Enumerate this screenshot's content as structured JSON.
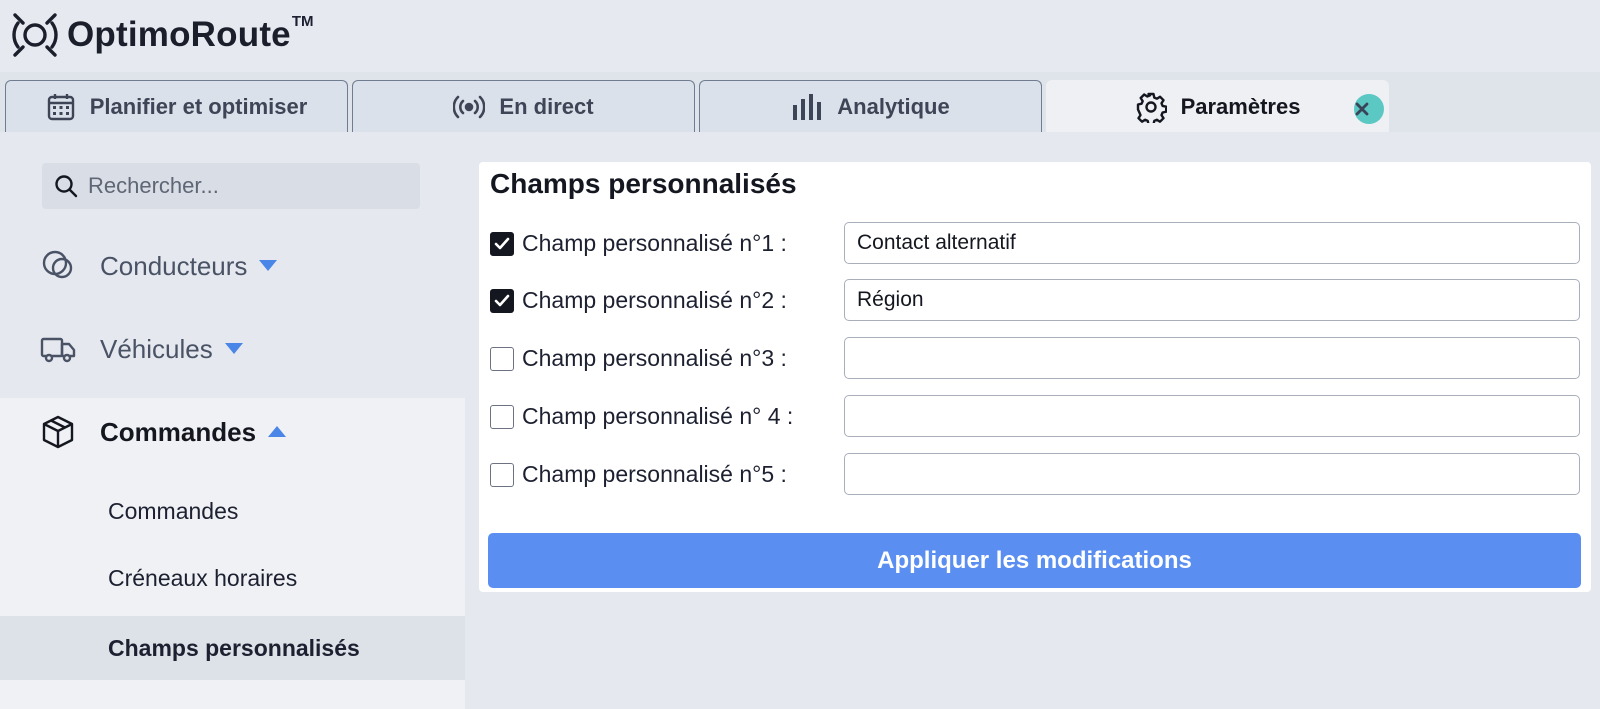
{
  "app": {
    "name": "OptimoRoute",
    "trademark": "TM"
  },
  "tabs": [
    {
      "label": "Planifier et optimiser",
      "icon": "calendar-icon"
    },
    {
      "label": "En direct",
      "icon": "broadcast-icon"
    },
    {
      "label": "Analytique",
      "icon": "bar-chart-icon"
    },
    {
      "label": "Paramètres",
      "icon": "gear-icon",
      "active": true
    }
  ],
  "sidebar": {
    "search_placeholder": "Rechercher...",
    "groups": [
      {
        "label": "Conducteurs",
        "icon": "drivers-icon",
        "expanded": false
      },
      {
        "label": "Véhicules",
        "icon": "truck-icon",
        "expanded": false
      },
      {
        "label": "Commandes",
        "icon": "package-icon",
        "expanded": true
      }
    ],
    "items": [
      {
        "label": "Commandes",
        "selected": false
      },
      {
        "label": "Créneaux horaires",
        "selected": false
      },
      {
        "label": "Champs personnalisés",
        "selected": true
      }
    ]
  },
  "panel": {
    "title": "Champs personnalisés",
    "fields": [
      {
        "label": "Champ personnalisé n°1 :",
        "checked": true,
        "value": "Contact alternatif"
      },
      {
        "label": "Champ personnalisé n°2 :",
        "checked": true,
        "value": "Région"
      },
      {
        "label": "Champ personnalisé n°3 :",
        "checked": false,
        "value": ""
      },
      {
        "label": "Champ personnalisé n° 4 :",
        "checked": false,
        "value": ""
      },
      {
        "label": "Champ personnalisé n°5 :",
        "checked": false,
        "value": ""
      }
    ],
    "apply_label": "Appliquer les modifications"
  },
  "colors": {
    "accent": "#5a8ef0",
    "close_button": "#5bc8c4"
  }
}
